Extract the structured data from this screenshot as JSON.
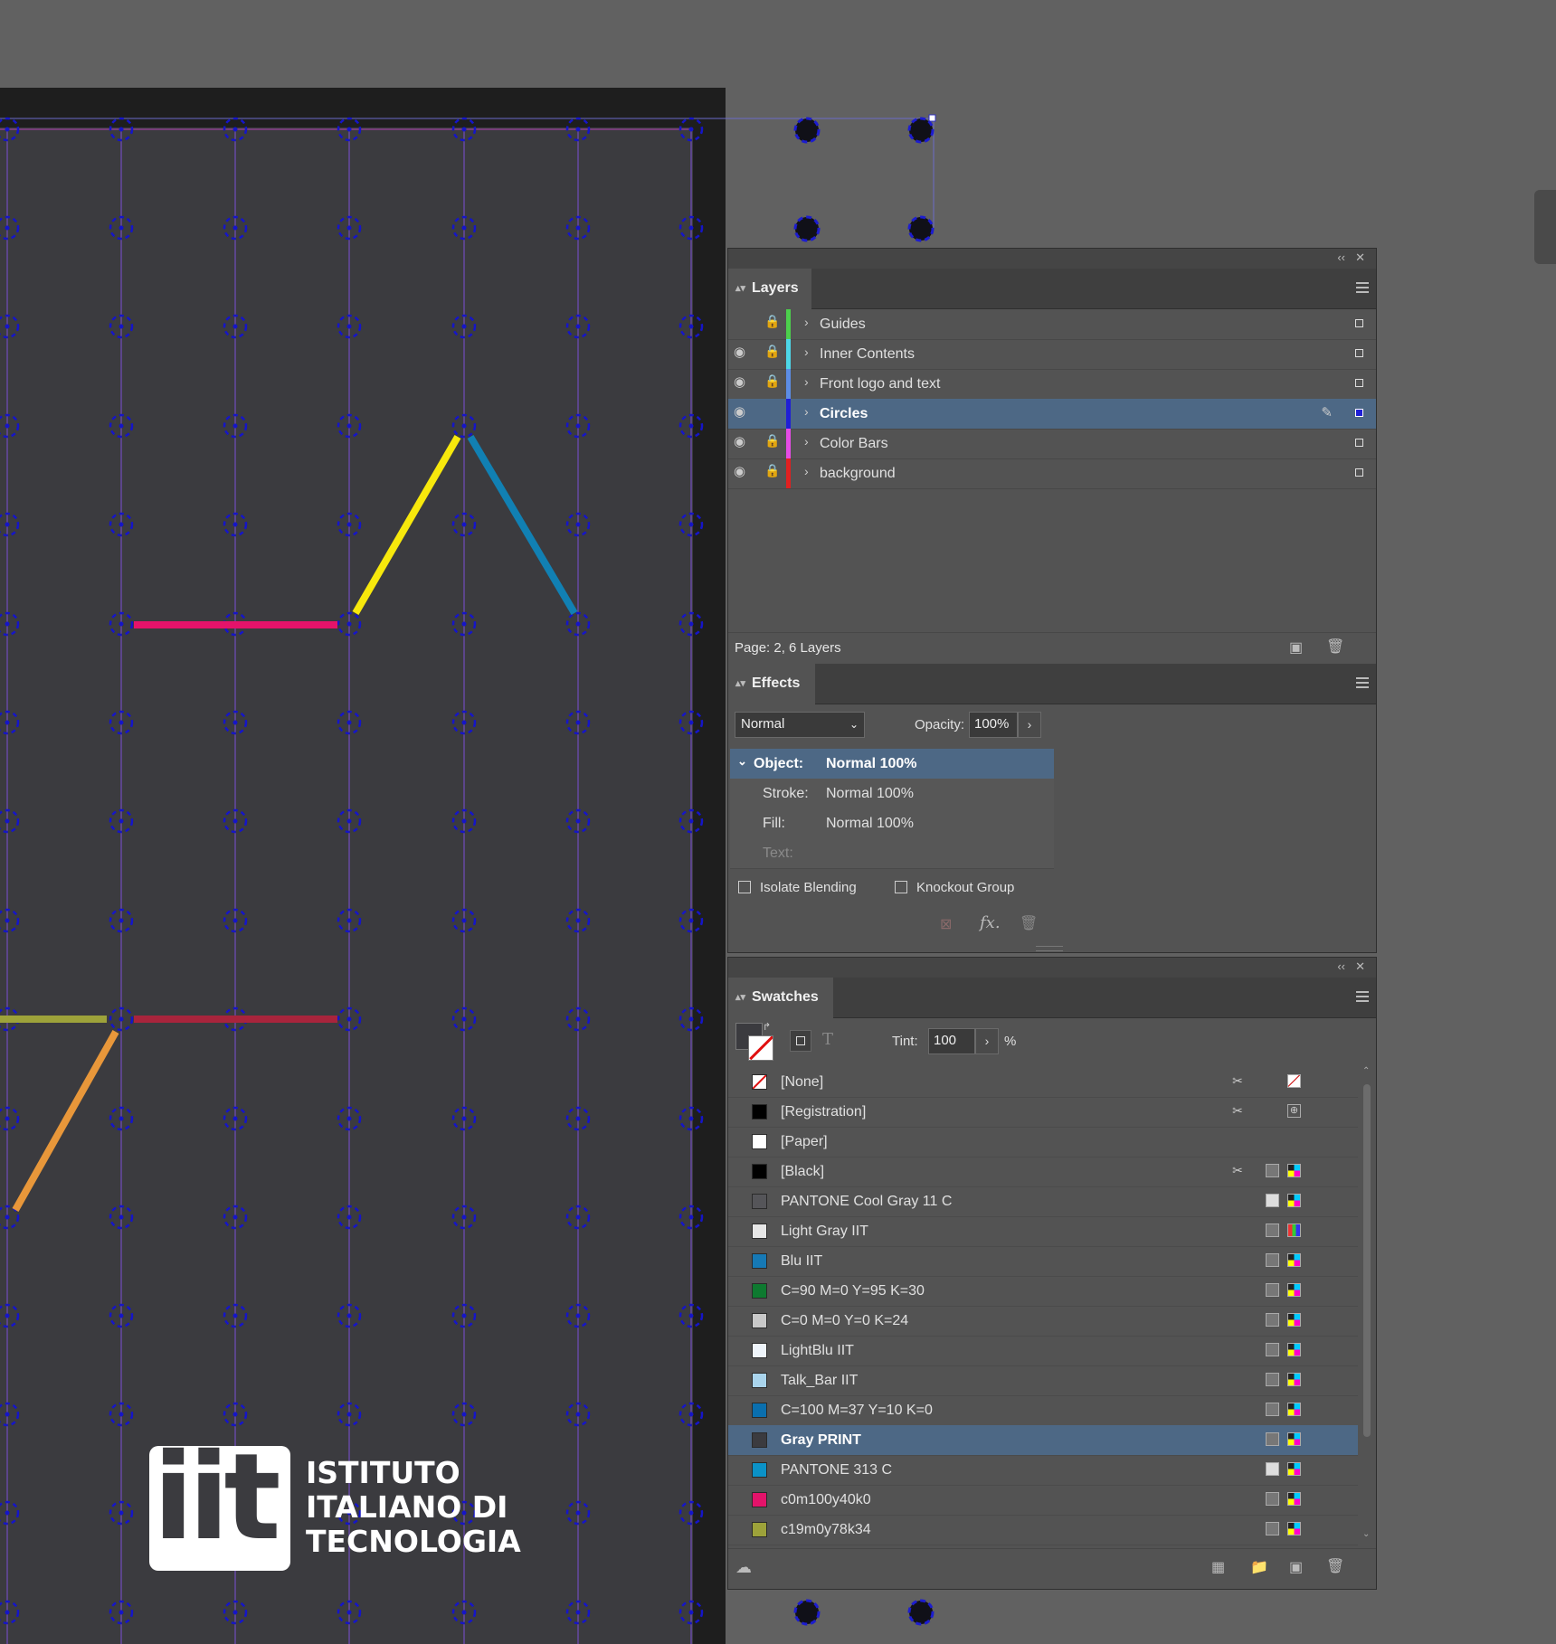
{
  "layers_panel": {
    "tab_label": "Layers",
    "footer": "Page: 2, 6 Layers",
    "layers": [
      {
        "name": "Guides",
        "color": "#4ccf4c",
        "visible": false,
        "locked": true,
        "selected": false
      },
      {
        "name": "Inner Contents",
        "color": "#4dd7e8",
        "visible": true,
        "locked": true,
        "selected": false
      },
      {
        "name": "Front logo and text",
        "color": "#5c8de6",
        "visible": true,
        "locked": true,
        "selected": false
      },
      {
        "name": "Circles",
        "color": "#1f1fd6",
        "visible": true,
        "locked": false,
        "selected": true
      },
      {
        "name": "Color Bars",
        "color": "#e64ce6",
        "visible": true,
        "locked": true,
        "selected": false
      },
      {
        "name": "background",
        "color": "#e02020",
        "visible": true,
        "locked": true,
        "selected": false
      }
    ]
  },
  "effects_panel": {
    "tab_label": "Effects",
    "blend_mode": "Normal",
    "opacity_label": "Opacity:",
    "opacity_value": "100%",
    "rows": [
      {
        "label": "Object:",
        "value": "Normal 100%"
      },
      {
        "label": "Stroke:",
        "value": "Normal 100%"
      },
      {
        "label": "Fill:",
        "value": "Normal 100%"
      },
      {
        "label": "Text:",
        "value": ""
      }
    ],
    "isolate_blending": "Isolate Blending",
    "knockout_group": "Knockout Group",
    "fx_label": "fx."
  },
  "swatches_panel": {
    "tab_label": "Swatches",
    "tint_label": "Tint:",
    "tint_value": "100",
    "tint_unit": "%",
    "swatches": [
      {
        "name": "[None]",
        "color": "none",
        "selected": false
      },
      {
        "name": "[Registration]",
        "color": "#000000",
        "selected": false
      },
      {
        "name": "[Paper]",
        "color": "#ffffff",
        "selected": false
      },
      {
        "name": "[Black]",
        "color": "#000000",
        "selected": false
      },
      {
        "name": "PANTONE Cool Gray 11 C",
        "color": "#555559",
        "selected": false
      },
      {
        "name": "Light Gray IIT",
        "color": "#e6e6e6",
        "selected": false
      },
      {
        "name": "Blu IIT",
        "color": "#1679b5",
        "selected": false
      },
      {
        "name": "C=90 M=0 Y=95 K=30",
        "color": "#0e7a30",
        "selected": false
      },
      {
        "name": "C=0 M=0 Y=0 K=24",
        "color": "#c8c8c8",
        "selected": false
      },
      {
        "name": "LightBlu IIT",
        "color": "#eef4fa",
        "selected": false
      },
      {
        "name": "Talk_Bar IIT",
        "color": "#a9d4ec",
        "selected": false
      },
      {
        "name": "C=100 M=37 Y=10 K=0",
        "color": "#0a6fae",
        "selected": false
      },
      {
        "name": "Gray PRINT",
        "color": "#3b3b3f",
        "selected": true
      },
      {
        "name": "PANTONE 313 C",
        "color": "#0b92c7",
        "selected": false
      },
      {
        "name": "c0m100y40k0",
        "color": "#e4136a",
        "selected": false
      },
      {
        "name": "c19m0y78k34",
        "color": "#9da23a",
        "selected": false
      }
    ]
  },
  "logo": {
    "mark": "iit",
    "line1": "ISTITUTO",
    "line2": "ITALIANO DI",
    "line3": "TECNOLOGIA"
  },
  "colors": {
    "page": "#3b3b3f",
    "grid_guide": "#7b4fd6",
    "handle": "#1515c8",
    "selection": "#4d6885",
    "line_pink": "#e4136a",
    "line_yellow": "#f7e80c",
    "line_blue": "#1180b3",
    "line_olive": "#9da23a",
    "line_red": "#a8243c",
    "line_orange": "#e8973a"
  }
}
